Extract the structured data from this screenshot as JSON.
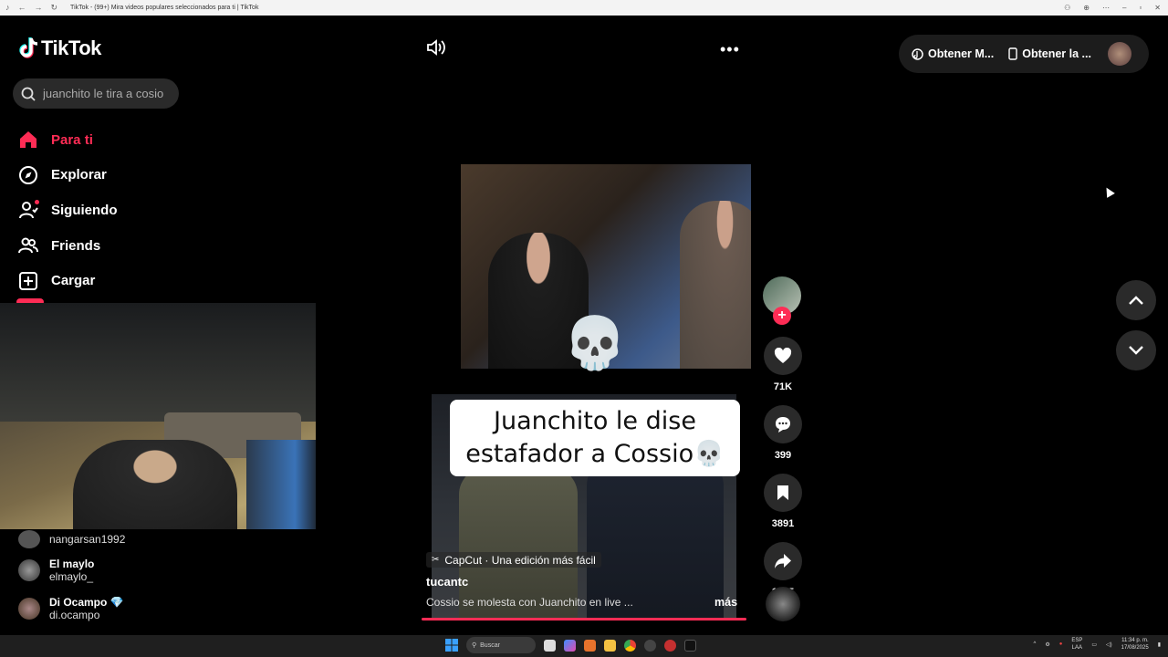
{
  "browser": {
    "title": "TikTok - (99+) Mira videos populares seleccionados para ti | TikTok"
  },
  "brand": {
    "name": "TikTok"
  },
  "search": {
    "value": "juanchito le tira a cosio"
  },
  "menu": [
    {
      "label": "Para ti",
      "icon": "home-icon"
    },
    {
      "label": "Explorar",
      "icon": "compass-icon"
    },
    {
      "label": "Siguiendo",
      "icon": "following-icon"
    },
    {
      "label": "Friends",
      "icon": "friends-icon"
    },
    {
      "label": "Cargar",
      "icon": "upload-icon"
    }
  ],
  "following": [
    {
      "name": "",
      "handle": "nangarsan1992"
    },
    {
      "name": "El maylo",
      "handle": "elmaylo_"
    },
    {
      "name": "Di Ocampo",
      "handle": "di.ocampo"
    }
  ],
  "topbar": {
    "get_coins": "Obtener M...",
    "get_app": "Obtener la ..."
  },
  "video": {
    "caption": "Juanchito le dise estafador a Cossio💀",
    "skull": "💀",
    "capcut": "CapCut · Una edición más fácil",
    "author": "tucantc",
    "description": "Cossio se molesta con Juanchito en live ...",
    "more": "más"
  },
  "actions": {
    "likes": "71K",
    "comments": "399",
    "saves": "3891",
    "shares": "1715"
  },
  "taskbar": {
    "search": "Buscar",
    "lang_top": "ESP",
    "lang_bottom": "LAA",
    "time": "11:34 p. m.",
    "date": "17/08/2025"
  },
  "colors": {
    "accent": "#fe2c55",
    "background": "#000000",
    "button_bg": "#2a2a2a"
  }
}
